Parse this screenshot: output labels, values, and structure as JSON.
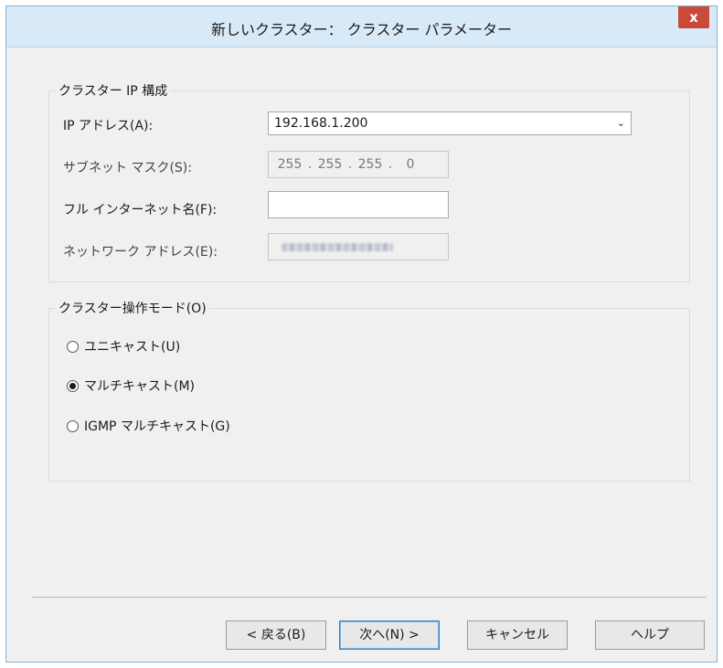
{
  "window": {
    "title": "新しいクラスター： クラスター パラメーター",
    "close_label": "x"
  },
  "ip_config": {
    "legend": "クラスター IP 構成",
    "ip_address_label": "IP アドレス(A):",
    "ip_address_value": "192.168.1.200",
    "subnet_label": "サブネット マスク(S):",
    "subnet_octets": [
      "255",
      "255",
      "255",
      "0"
    ],
    "fqdn_label": "フル インターネット名(F):",
    "fqdn_value": "",
    "network_address_label": "ネットワーク アドレス(E):"
  },
  "operation_mode": {
    "legend": "クラスター操作モード(O)",
    "options": [
      {
        "label": "ユニキャスト(U)",
        "checked": false
      },
      {
        "label": "マルチキャスト(M)",
        "checked": true
      },
      {
        "label": "IGMP マルチキャスト(G)",
        "checked": false
      }
    ]
  },
  "buttons": {
    "back": "< 戻る(B)",
    "next": "次へ(N) >",
    "cancel": "キャンセル",
    "help": "ヘルプ"
  }
}
